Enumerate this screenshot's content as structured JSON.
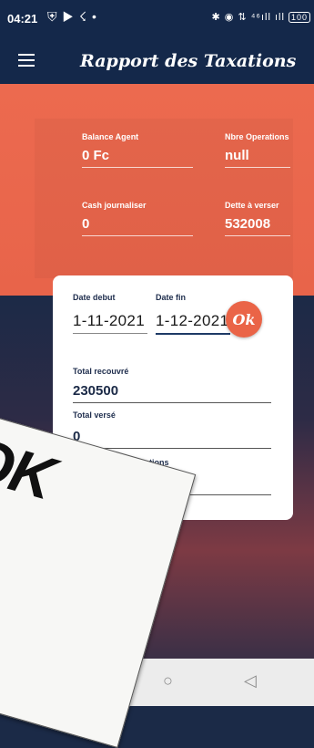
{
  "status_bar": {
    "time": "04:21",
    "left_icons": [
      "shield-icon",
      "youtube-icon",
      "messenger-icon"
    ],
    "right_text": "✱ ◉ ⇅ ⁴⁶ıll ıll",
    "battery": "100"
  },
  "app_bar": {
    "title": "Rapport des Taxations"
  },
  "stats": {
    "balance_agent": {
      "label": "Balance Agent",
      "value": "0 Fc"
    },
    "nbre_operations": {
      "label": "Nbre Operations",
      "value": "null"
    },
    "cash_journaliser": {
      "label": "Cash journaliser",
      "value": "0"
    },
    "dette_a_verser": {
      "label": "Dette à verser",
      "value": "532008"
    }
  },
  "filter": {
    "date_debut_label": "Date debut",
    "date_debut_value": "1-11-2021",
    "date_fin_label": "Date fin",
    "date_fin_value": "1-12-2021",
    "ok_label": "Ok"
  },
  "totals": {
    "total_recouvre": {
      "label": "Total recouvré",
      "value": "230500"
    },
    "total_verse": {
      "label": "Total versé",
      "value": "0"
    },
    "nombre_total_operations": {
      "label": "Nombre total Operations",
      "value": ""
    }
  },
  "paper_overlay": {
    "text": "OK"
  },
  "nav_bar": {
    "back": "◁",
    "home": "○",
    "recents": "□"
  },
  "colors": {
    "primary": "#14284a",
    "accent": "#ea6447"
  }
}
